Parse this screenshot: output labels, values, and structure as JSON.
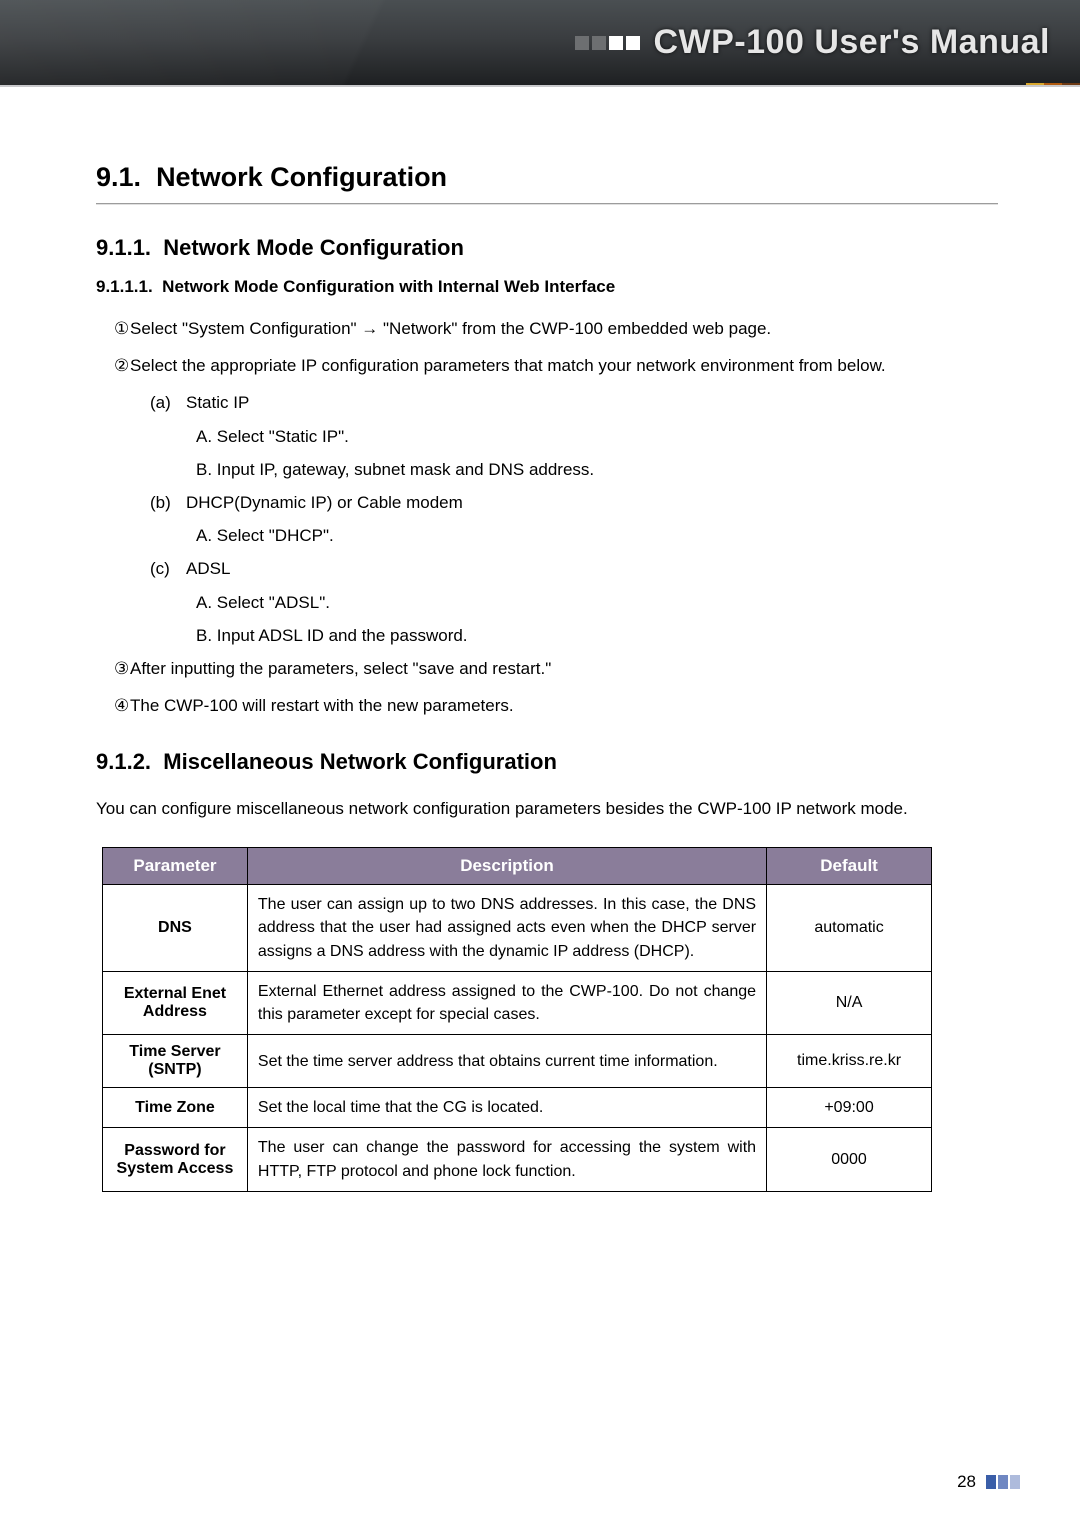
{
  "header": {
    "title": "CWP-100 User's Manual"
  },
  "section": {
    "num": "9.1.",
    "title": "Network Configuration"
  },
  "sub1": {
    "num": "9.1.1.",
    "title": "Network Mode Configuration"
  },
  "sub1_1": {
    "num": "9.1.1.1.",
    "title": "Network Mode Configuration with Internal Web Interface"
  },
  "steps": {
    "s1": "Select \"System Configuration\" → \"Network\" from the CWP-100 embedded web page.",
    "s2": "Select the appropriate IP configuration parameters that match your network environment from below.",
    "a_label": "(a)",
    "a_text": "Static IP",
    "a_A": "A. Select \"Static IP\".",
    "a_B": "B. Input IP, gateway, subnet mask and DNS address.",
    "b_label": "(b)",
    "b_text": "DHCP(Dynamic IP) or Cable modem",
    "b_A": "A. Select \"DHCP\".",
    "c_label": "(c)",
    "c_text": "ADSL",
    "c_A": "A.  Select \"ADSL\".",
    "c_B": "B.  Input ADSL ID and the password.",
    "s3": "After inputting the parameters, select \"save and restart.\"",
    "s4": "The CWP-100 will restart with the new parameters."
  },
  "sub2": {
    "num": "9.1.2.",
    "title": "Miscellaneous Network Configuration"
  },
  "intro": "You can configure miscellaneous network configuration parameters besides the CWP-100 IP network mode.",
  "table": {
    "headers": {
      "param": "Parameter",
      "desc": "Description",
      "def": "Default"
    },
    "rows": [
      {
        "param": "DNS",
        "desc": "The user can assign up to two DNS addresses. In this case, the DNS address that the user had assigned acts even when the DHCP server assigns a DNS address with the dynamic IP address (DHCP).",
        "def": "automatic"
      },
      {
        "param": "External Enet Address",
        "desc": "External Ethernet address assigned to the CWP-100. Do not change this parameter except for special cases.",
        "def": "N/A"
      },
      {
        "param": "Time Server (SNTP)",
        "desc": "Set the time server address that obtains current time information.",
        "def": "time.kriss.re.kr"
      },
      {
        "param": "Time Zone",
        "desc": "Set the local time that the CG is located.",
        "def": "+09:00"
      },
      {
        "param": "Password for System Access",
        "desc": "The user can change the password for accessing the system with HTTP, FTP protocol and phone lock function.",
        "def": "0000"
      }
    ]
  },
  "page_number": "28"
}
